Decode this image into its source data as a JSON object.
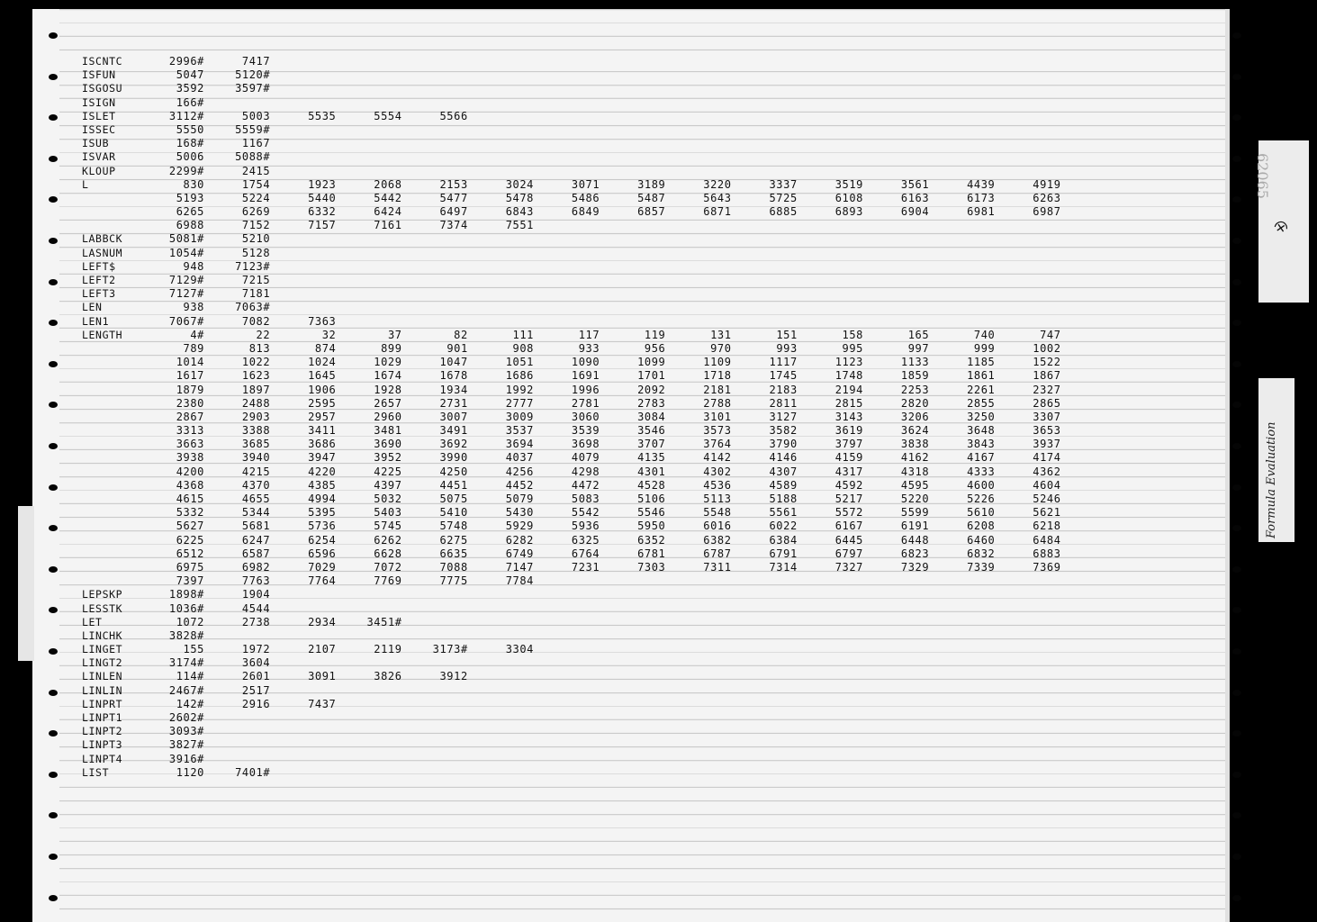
{
  "rows": [
    {
      "symbol": "ISCNTC",
      "refs": [
        "2996#",
        "7417"
      ]
    },
    {
      "symbol": "ISFUN",
      "refs": [
        "5047",
        "5120#"
      ]
    },
    {
      "symbol": "ISGOSU",
      "refs": [
        "3592",
        "3597#"
      ]
    },
    {
      "symbol": "ISIGN",
      "refs": [
        "166#"
      ]
    },
    {
      "symbol": "ISLET",
      "refs": [
        "3112#",
        "5003",
        "5535",
        "5554",
        "5566"
      ]
    },
    {
      "symbol": "ISSEC",
      "refs": [
        "5550",
        "5559#"
      ]
    },
    {
      "symbol": "ISUB",
      "refs": [
        "168#",
        "1167"
      ]
    },
    {
      "symbol": "ISVAR",
      "refs": [
        "5006",
        "5088#"
      ]
    },
    {
      "symbol": "KLOUP",
      "refs": [
        "2299#",
        "2415"
      ]
    },
    {
      "symbol": "L",
      "refs": [
        "830",
        "1754",
        "1923",
        "2068",
        "2153",
        "3024",
        "3071",
        "3189",
        "3220",
        "3337",
        "3519",
        "3561",
        "4439",
        "4919"
      ]
    },
    {
      "symbol": "",
      "refs": [
        "5193",
        "5224",
        "5440",
        "5442",
        "5477",
        "5478",
        "5486",
        "5487",
        "5643",
        "5725",
        "6108",
        "6163",
        "6173",
        "6263"
      ]
    },
    {
      "symbol": "",
      "refs": [
        "6265",
        "6269",
        "6332",
        "6424",
        "6497",
        "6843",
        "6849",
        "6857",
        "6871",
        "6885",
        "6893",
        "6904",
        "6981",
        "6987"
      ]
    },
    {
      "symbol": "",
      "refs": [
        "6988",
        "7152",
        "7157",
        "7161",
        "7374",
        "7551"
      ]
    },
    {
      "symbol": "LABBCK",
      "refs": [
        "5081#",
        "5210"
      ]
    },
    {
      "symbol": "LASNUM",
      "refs": [
        "1054#",
        "5128"
      ]
    },
    {
      "symbol": "LEFT$",
      "refs": [
        "948",
        "7123#"
      ]
    },
    {
      "symbol": "LEFT2",
      "refs": [
        "7129#",
        "7215"
      ]
    },
    {
      "symbol": "LEFT3",
      "refs": [
        "7127#",
        "7181"
      ]
    },
    {
      "symbol": "LEN",
      "refs": [
        "938",
        "7063#"
      ]
    },
    {
      "symbol": "LEN1",
      "refs": [
        "7067#",
        "7082",
        "7363"
      ]
    },
    {
      "symbol": "LENGTH",
      "refs": [
        "4#",
        "22",
        "32",
        "37",
        "82",
        "111",
        "117",
        "119",
        "131",
        "151",
        "158",
        "165",
        "740",
        "747"
      ]
    },
    {
      "symbol": "",
      "refs": [
        "789",
        "813",
        "874",
        "899",
        "901",
        "908",
        "933",
        "956",
        "970",
        "993",
        "995",
        "997",
        "999",
        "1002"
      ]
    },
    {
      "symbol": "",
      "refs": [
        "1014",
        "1022",
        "1024",
        "1029",
        "1047",
        "1051",
        "1090",
        "1099",
        "1109",
        "1117",
        "1123",
        "1133",
        "1185",
        "1522"
      ]
    },
    {
      "symbol": "",
      "refs": [
        "1617",
        "1623",
        "1645",
        "1674",
        "1678",
        "1686",
        "1691",
        "1701",
        "1718",
        "1745",
        "1748",
        "1859",
        "1861",
        "1867"
      ]
    },
    {
      "symbol": "",
      "refs": [
        "1879",
        "1897",
        "1906",
        "1928",
        "1934",
        "1992",
        "1996",
        "2092",
        "2181",
        "2183",
        "2194",
        "2253",
        "2261",
        "2327"
      ]
    },
    {
      "symbol": "",
      "refs": [
        "2380",
        "2488",
        "2595",
        "2657",
        "2731",
        "2777",
        "2781",
        "2783",
        "2788",
        "2811",
        "2815",
        "2820",
        "2855",
        "2865"
      ]
    },
    {
      "symbol": "",
      "refs": [
        "2867",
        "2903",
        "2957",
        "2960",
        "3007",
        "3009",
        "3060",
        "3084",
        "3101",
        "3127",
        "3143",
        "3206",
        "3250",
        "3307"
      ]
    },
    {
      "symbol": "",
      "refs": [
        "3313",
        "3388",
        "3411",
        "3481",
        "3491",
        "3537",
        "3539",
        "3546",
        "3573",
        "3582",
        "3619",
        "3624",
        "3648",
        "3653"
      ]
    },
    {
      "symbol": "",
      "refs": [
        "3663",
        "3685",
        "3686",
        "3690",
        "3692",
        "3694",
        "3698",
        "3707",
        "3764",
        "3790",
        "3797",
        "3838",
        "3843",
        "3937"
      ]
    },
    {
      "symbol": "",
      "refs": [
        "3938",
        "3940",
        "3947",
        "3952",
        "3990",
        "4037",
        "4079",
        "4135",
        "4142",
        "4146",
        "4159",
        "4162",
        "4167",
        "4174"
      ]
    },
    {
      "symbol": "",
      "refs": [
        "4200",
        "4215",
        "4220",
        "4225",
        "4250",
        "4256",
        "4298",
        "4301",
        "4302",
        "4307",
        "4317",
        "4318",
        "4333",
        "4362"
      ]
    },
    {
      "symbol": "",
      "refs": [
        "4368",
        "4370",
        "4385",
        "4397",
        "4451",
        "4452",
        "4472",
        "4528",
        "4536",
        "4589",
        "4592",
        "4595",
        "4600",
        "4604"
      ]
    },
    {
      "symbol": "",
      "refs": [
        "4615",
        "4655",
        "4994",
        "5032",
        "5075",
        "5079",
        "5083",
        "5106",
        "5113",
        "5188",
        "5217",
        "5220",
        "5226",
        "5246"
      ]
    },
    {
      "symbol": "",
      "refs": [
        "5332",
        "5344",
        "5395",
        "5403",
        "5410",
        "5430",
        "5542",
        "5546",
        "5548",
        "5561",
        "5572",
        "5599",
        "5610",
        "5621"
      ]
    },
    {
      "symbol": "",
      "refs": [
        "5627",
        "5681",
        "5736",
        "5745",
        "5748",
        "5929",
        "5936",
        "5950",
        "6016",
        "6022",
        "6167",
        "6191",
        "6208",
        "6218"
      ]
    },
    {
      "symbol": "",
      "refs": [
        "6225",
        "6247",
        "6254",
        "6262",
        "6275",
        "6282",
        "6325",
        "6352",
        "6382",
        "6384",
        "6445",
        "6448",
        "6460",
        "6484"
      ]
    },
    {
      "symbol": "",
      "refs": [
        "6512",
        "6587",
        "6596",
        "6628",
        "6635",
        "6749",
        "6764",
        "6781",
        "6787",
        "6791",
        "6797",
        "6823",
        "6832",
        "6883"
      ]
    },
    {
      "symbol": "",
      "refs": [
        "6975",
        "6982",
        "7029",
        "7072",
        "7088",
        "7147",
        "7231",
        "7303",
        "7311",
        "7314",
        "7327",
        "7329",
        "7339",
        "7369"
      ]
    },
    {
      "symbol": "",
      "refs": [
        "7397",
        "7763",
        "7764",
        "7769",
        "7775",
        "7784"
      ]
    },
    {
      "symbol": "LEPSKP",
      "refs": [
        "1898#",
        "1904"
      ]
    },
    {
      "symbol": "LESSTK",
      "refs": [
        "1036#",
        "4544"
      ]
    },
    {
      "symbol": "LET",
      "refs": [
        "1072",
        "2738",
        "2934",
        "3451#"
      ]
    },
    {
      "symbol": "LINCHK",
      "refs": [
        "3828#"
      ]
    },
    {
      "symbol": "LINGET",
      "refs": [
        "155",
        "1972",
        "2107",
        "2119",
        "3173#",
        "3304"
      ]
    },
    {
      "symbol": "LINGT2",
      "refs": [
        "3174#",
        "3604"
      ]
    },
    {
      "symbol": "LINLEN",
      "refs": [
        "114#",
        "2601",
        "3091",
        "3826",
        "3912"
      ]
    },
    {
      "symbol": "LINLIN",
      "refs": [
        "2467#",
        "2517"
      ]
    },
    {
      "symbol": "LINPRT",
      "refs": [
        "142#",
        "2916",
        "7437"
      ]
    },
    {
      "symbol": "LINPT1",
      "refs": [
        "2602#"
      ]
    },
    {
      "symbol": "LINPT2",
      "refs": [
        "3093#"
      ]
    },
    {
      "symbol": "LINPT3",
      "refs": [
        "3827#"
      ]
    },
    {
      "symbol": "LINPT4",
      "refs": [
        "3916#"
      ]
    },
    {
      "symbol": "LIST",
      "refs": [
        "1120",
        "7401#"
      ]
    }
  ],
  "tabs": {
    "upper_text": "62065",
    "lower_text": "Formula Evaluation"
  }
}
